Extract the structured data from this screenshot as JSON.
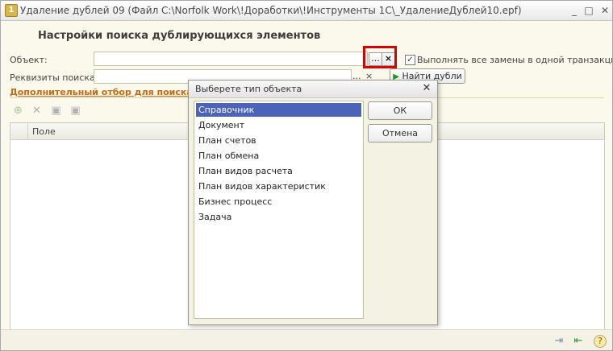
{
  "window": {
    "title": "Удаление дублей 09 (Файл C:\\Norfolk Work\\!Доработки\\!Инструменты 1С\\_УдалениеДублей10.epf)",
    "icon_letter": "1",
    "controls": {
      "minimize": "_",
      "maximize": "□",
      "close": "✕"
    }
  },
  "form": {
    "header": "Настройки поиска дублирующихся элементов",
    "object_label": "Объект:",
    "object_value": "",
    "select_button": "...",
    "clear_button": "×",
    "checkbox_label": "Выполнять все замены в одной транзакции",
    "checkbox_checked": true,
    "search_fields_label": "Реквизиты поиска:",
    "search_fields_value": "",
    "search_select_button": "...",
    "search_clear_button": "×",
    "find_button": "Найти дубли",
    "extra_filter_title": "Дополнительный отбор для поиска",
    "grid_column": "Поле"
  },
  "toolbar_icons": [
    "add-icon",
    "delete-icon",
    "check-all-icon",
    "uncheck-all-icon"
  ],
  "dialog": {
    "title": "Выберете тип объекта",
    "close": "✕",
    "items": [
      "Справочник",
      "Документ",
      "План счетов",
      "План обмена",
      "План видов расчета",
      "План видов характеристик",
      "Бизнес процесс",
      "Задача"
    ],
    "selected_index": 0,
    "ok_button": "ОК",
    "cancel_button": "Отмена"
  },
  "statusbar_icons": [
    "export-icon",
    "import-icon",
    "help-icon"
  ],
  "colors": {
    "form_background": "#fbf9ec",
    "accent_section": "#c46a16",
    "highlight_frame": "#d90000",
    "list_selection": "#4b63b8"
  }
}
